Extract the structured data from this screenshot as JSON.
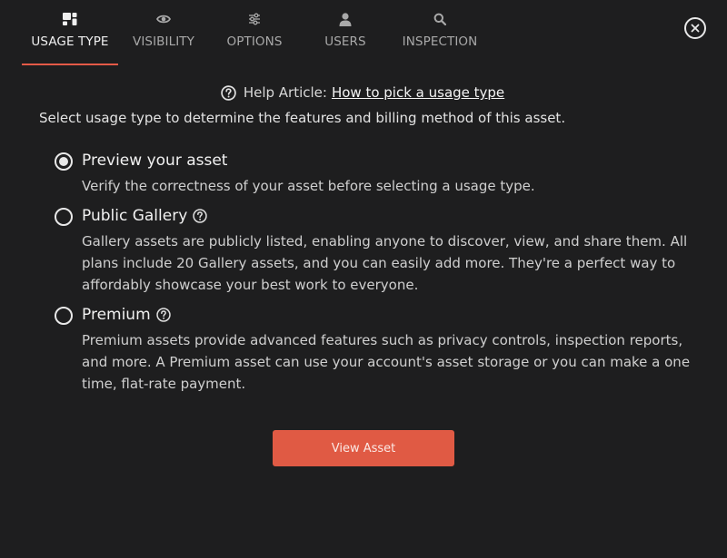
{
  "tabs": [
    {
      "label": "USAGE TYPE",
      "icon": "usage-type-icon",
      "active": true
    },
    {
      "label": "VISIBILITY",
      "icon": "eye-icon",
      "active": false
    },
    {
      "label": "OPTIONS",
      "icon": "sliders-icon",
      "active": false
    },
    {
      "label": "USERS",
      "icon": "user-icon",
      "active": false
    },
    {
      "label": "INSPECTION",
      "icon": "search-icon",
      "active": false
    }
  ],
  "help": {
    "prefix": "Help Article:",
    "link_text": "How to pick a usage type"
  },
  "intro": "Select usage type to determine the features and billing method of this asset.",
  "options": [
    {
      "title": "Preview your asset",
      "description": "Verify the correctness of your asset before selecting a usage type.",
      "selected": true
    },
    {
      "title": "Public Gallery",
      "description": "Gallery assets are publicly listed, enabling anyone to discover, view, and share them. All plans include 20 Gallery assets, and you can easily add more. They're a perfect way to affordably showcase your best work to everyone.",
      "selected": false
    },
    {
      "title": "Premium",
      "description": "Premium assets provide advanced features such as privacy controls, inspection reports, and more. A Premium asset can use your account's asset storage or you can make a one time, flat-rate payment.",
      "selected": false
    }
  ],
  "primary_button": "View Asset",
  "colors": {
    "background": "#1e1e1f",
    "accent": "#e05a44",
    "tab_underline": "#e55a47"
  }
}
